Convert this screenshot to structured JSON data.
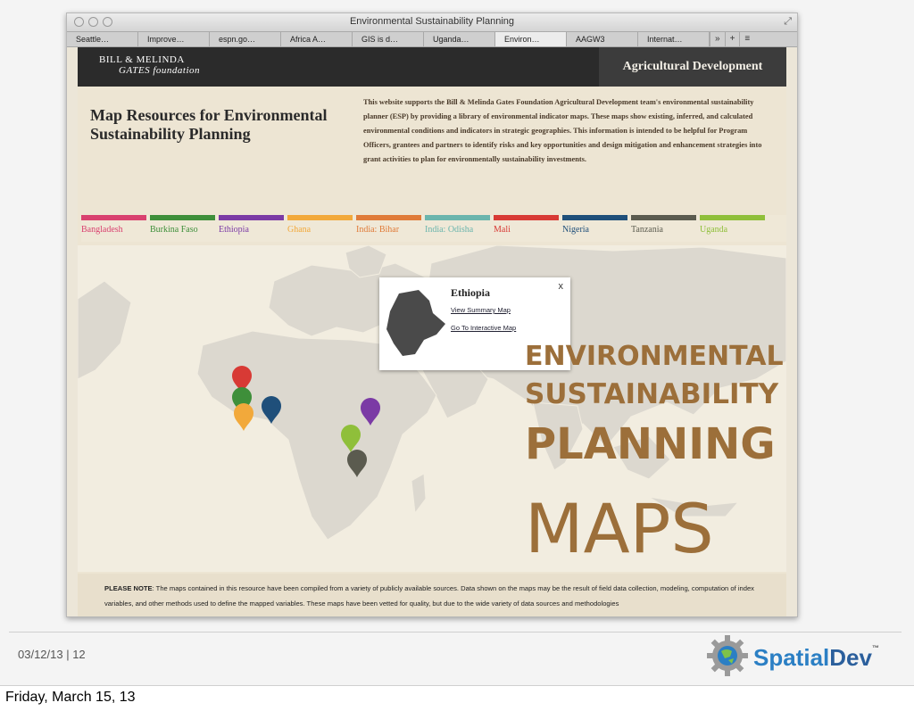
{
  "browser": {
    "title": "Environmental Sustainability Planning",
    "tabs": [
      "Seattle…",
      "Improve…",
      "espn.go…",
      "Africa A…",
      "GIS is d…",
      "Uganda…",
      "Environ…",
      "AAGW3",
      "Internat…"
    ],
    "active_tab": 6,
    "tab_more": "»",
    "tab_add": "+",
    "tab_menu": "≡"
  },
  "site": {
    "logo_line1": "BILL & MELINDA",
    "logo_line2": "GATES foundation",
    "section": "Agricultural Development",
    "title": "Map Resources for Environmental Sustainability Planning",
    "intro": "This website supports the Bill & Melinda Gates Foundation Agricultural Development team's environmental sustainability planner (ESP) by providing a library of environmental indicator maps. These maps show existing, inferred, and calculated environmental conditions and indicators in strategic geographies. This information is intended to be helpful for Program Officers, grantees and partners to identify risks and key opportunities and design mitigation and enhancement strategies into grant activities to plan for environmentally sustainability investments.",
    "countries": [
      {
        "name": "Bangladesh",
        "color": "#d9416f"
      },
      {
        "name": "Burkina Faso",
        "color": "#3e8f3a"
      },
      {
        "name": "Ethiopia",
        "color": "#7b3aa5"
      },
      {
        "name": "Ghana",
        "color": "#f2a93b"
      },
      {
        "name": "India: Bihar",
        "color": "#e07b39"
      },
      {
        "name": "India: Odisha",
        "color": "#6bb5ad"
      },
      {
        "name": "Mali",
        "color": "#d83a35"
      },
      {
        "name": "Nigeria",
        "color": "#1f4f7a"
      },
      {
        "name": "Tanzania",
        "color": "#5b5b4f"
      },
      {
        "name": "Uganda",
        "color": "#8fbf3a"
      }
    ],
    "popup": {
      "title": "Ethiopia",
      "link1": "View Summary Map",
      "link2": "Go To Interactive Map",
      "close": "x"
    },
    "notice_label": "PLEASE NOTE",
    "notice_text": ": The maps contained in this resource have been compiled from a variety of publicly available sources. Data shown on the maps may be the result of field data collection, modeling, computation of index variables, and other methods used to define the mapped variables. These maps have been vetted for quality, but due to the wide variety of data sources and methodologies"
  },
  "overlay": {
    "line1": "ENVIRONMENTAL",
    "line2": "SUSTAINABILITY",
    "line3": "PLANNING",
    "line4": "MAPS",
    "color": "#9c6f3a"
  },
  "slide": {
    "footer": "03/12/13  |  12",
    "brand_a": "Spatial",
    "brand_b": "Dev",
    "brand_tm": "™",
    "caption": "Friday, March 15, 13"
  }
}
